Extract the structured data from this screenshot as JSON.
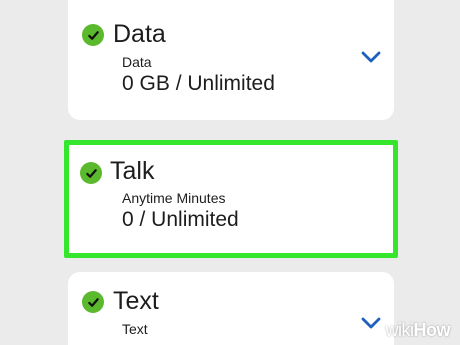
{
  "colors": {
    "background": "#ebebeb",
    "card": "#ffffff",
    "check_green": "#5bb92e",
    "highlight_border": "#35e62c",
    "chevron_blue": "#1f5fbf"
  },
  "cards": [
    {
      "title": "Data",
      "subtitle": "Data",
      "value": "0 GB / Unlimited",
      "icon": "checkmark-circle-icon",
      "expand_icon": "chevron-down-icon",
      "highlighted": false
    },
    {
      "title": "Talk",
      "subtitle": "Anytime Minutes",
      "value": "0 / Unlimited",
      "icon": "checkmark-circle-icon",
      "highlighted": true
    },
    {
      "title": "Text",
      "subtitle": "Text",
      "icon": "checkmark-circle-icon",
      "expand_icon": "chevron-down-icon",
      "highlighted": false
    }
  ],
  "watermark": {
    "part1": "wiki",
    "part2": "How"
  }
}
